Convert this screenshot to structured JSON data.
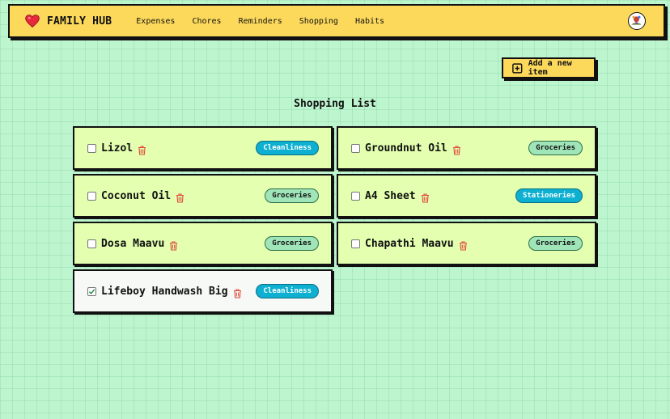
{
  "app": {
    "title": "FAMILY HUB",
    "logo_icon": "heart-icon"
  },
  "nav": {
    "links": [
      "Expenses",
      "Chores",
      "Reminders",
      "Shopping",
      "Habits"
    ]
  },
  "actions": {
    "add_label": "Add a new item"
  },
  "page": {
    "title": "Shopping List"
  },
  "colors": {
    "navbar": "#fcd95b",
    "card": "#e3ffaf",
    "card_checked": "#f7f9f6",
    "badge_blue": "#0eb0d1",
    "badge_green": "#9fe5b8",
    "trash": "#e04a3c"
  },
  "items": [
    {
      "name": "Lizol",
      "category": "Cleanliness",
      "checked": false
    },
    {
      "name": "Groundnut Oil",
      "category": "Groceries",
      "checked": false
    },
    {
      "name": "Coconut Oil",
      "category": "Groceries",
      "checked": false
    },
    {
      "name": "A4 Sheet",
      "category": "Stationeries",
      "checked": false
    },
    {
      "name": "Dosa Maavu",
      "category": "Groceries",
      "checked": false
    },
    {
      "name": "Chapathi Maavu",
      "category": "Groceries",
      "checked": false
    },
    {
      "name": "Lifeboy Handwash Big",
      "category": "Cleanliness",
      "checked": true
    }
  ]
}
